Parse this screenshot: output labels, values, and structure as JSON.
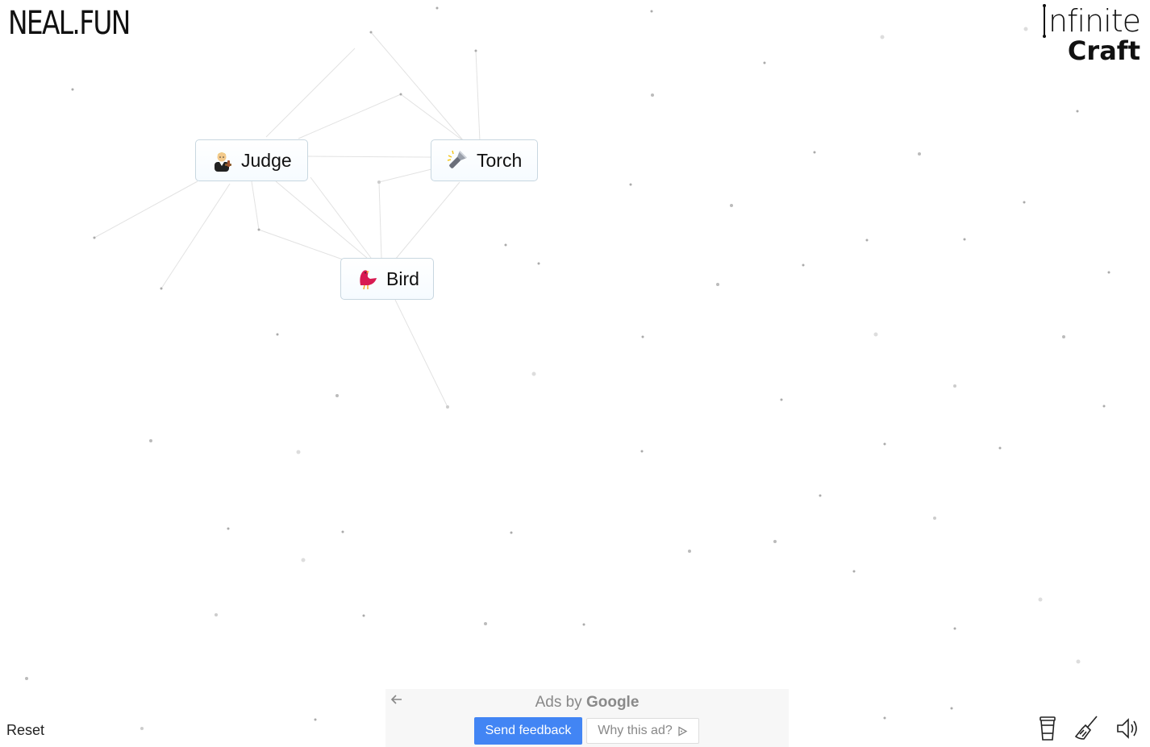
{
  "header": {
    "site_logo": "NEAL.FUN",
    "brand_line1": "nfinite",
    "brand_line2": "Craft"
  },
  "items": [
    {
      "label": "Judge",
      "icon": "judge-icon"
    },
    {
      "label": "Torch",
      "icon": "flashlight-icon"
    },
    {
      "label": "Bird",
      "icon": "bird-icon"
    }
  ],
  "footer": {
    "reset_label": "Reset",
    "tools": [
      "cup-icon",
      "broom-icon",
      "speaker-icon"
    ]
  },
  "ad": {
    "ads_by_prefix": "Ads by ",
    "ads_by_brand": "Google",
    "send_feedback_label": "Send feedback",
    "why_this_ad_label": "Why this ad?"
  },
  "colors": {
    "item_border": "#c8d7e0",
    "send_feedback_bg": "#4285f4",
    "dot": "#bdbdbd",
    "line": "#dedede"
  }
}
